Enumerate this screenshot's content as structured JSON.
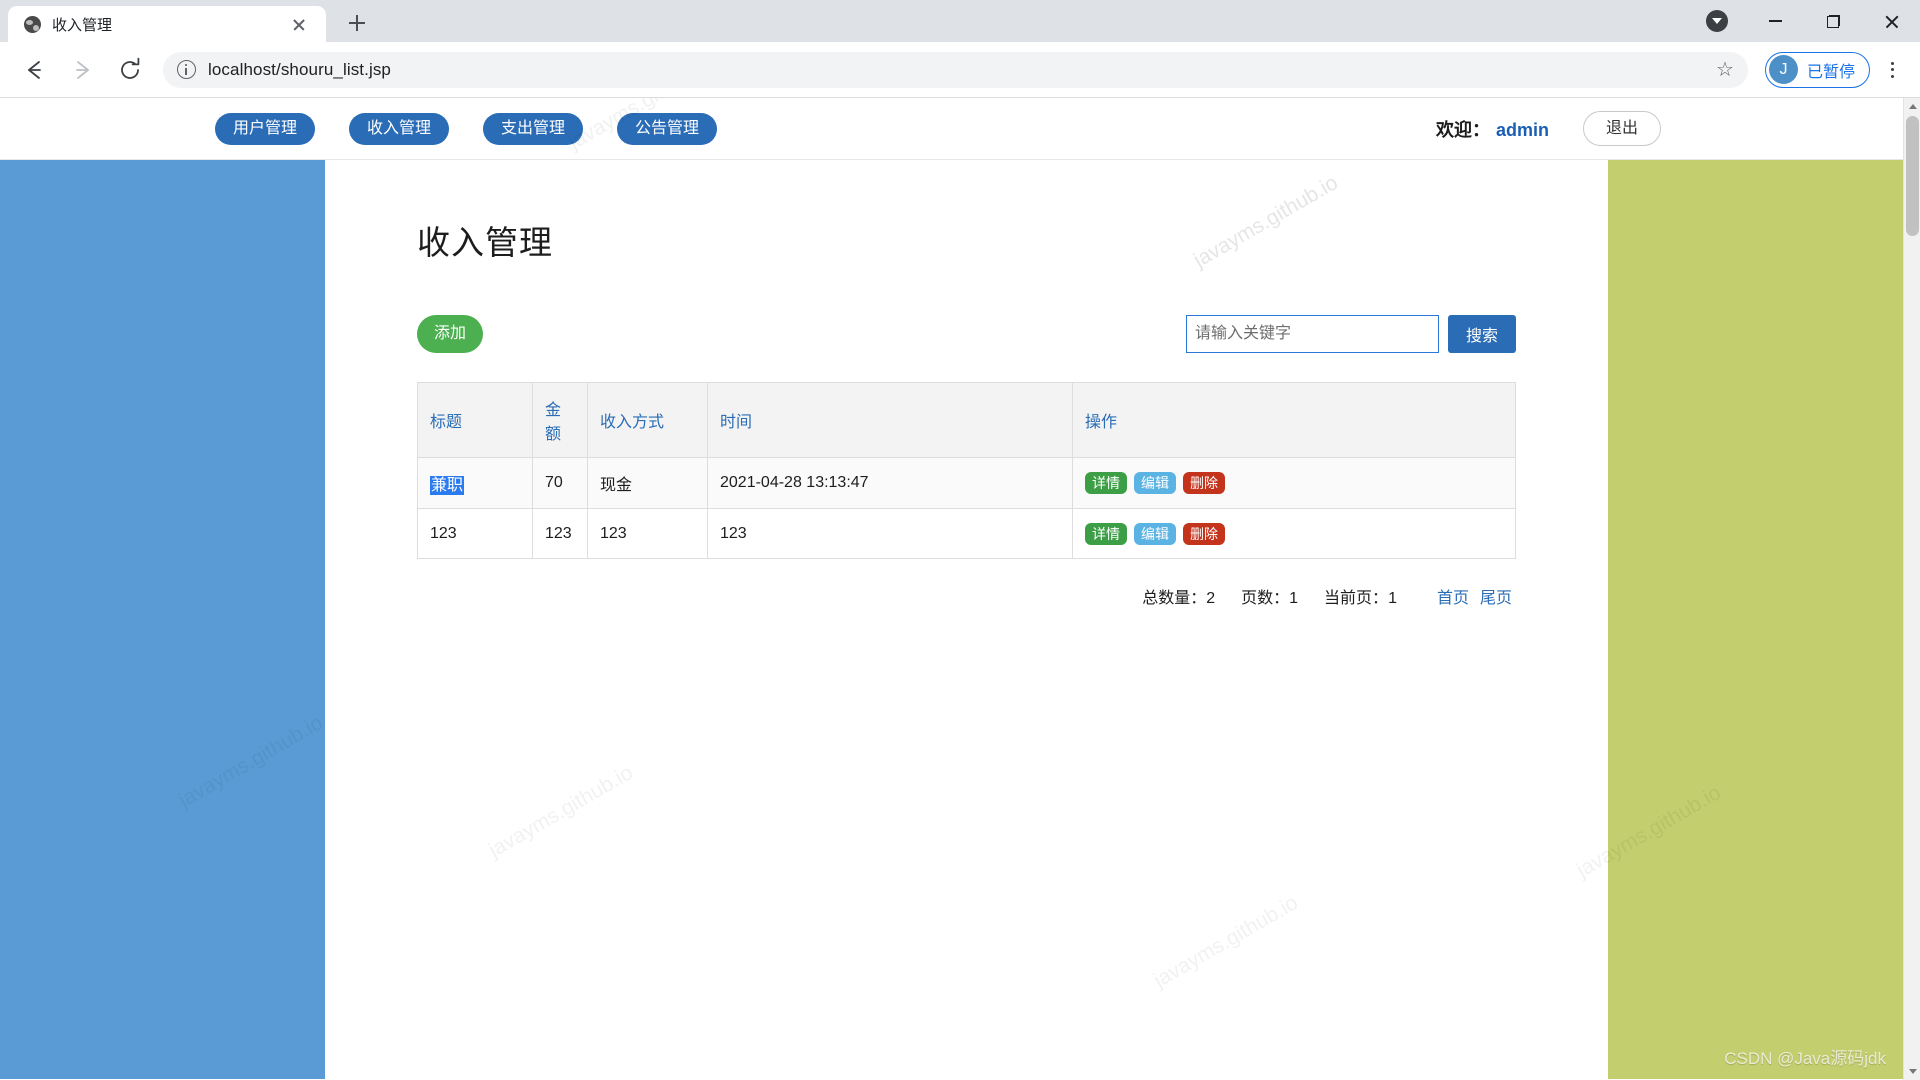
{
  "browser": {
    "tab": {
      "title": "收入管理",
      "favicon": "globe-icon",
      "close": "×"
    },
    "new_tab": "+",
    "url": "localhost/shouru_list.jsp",
    "profile": {
      "initial": "J",
      "label": "已暂停"
    },
    "window_controls": {
      "download": "download-icon",
      "minimize": "—",
      "maximize": "□",
      "close": "✕"
    }
  },
  "site": {
    "nav": [
      {
        "label": "用户管理"
      },
      {
        "label": "收入管理"
      },
      {
        "label": "支出管理"
      },
      {
        "label": "公告管理"
      }
    ],
    "welcome_prefix": "欢迎：",
    "welcome_user": "admin",
    "logout": "退出"
  },
  "main": {
    "title": "收入管理",
    "add_button": "添加",
    "search": {
      "placeholder": "请输入关键字",
      "value": "",
      "button": "搜索"
    },
    "table": {
      "headers": [
        "标题",
        "金额",
        "收入方式",
        "时间",
        "操作"
      ],
      "rows": [
        {
          "title": "兼职",
          "title_selected": true,
          "amount": "70",
          "way": "现金",
          "time": "2021-04-28 13:13:47",
          "actions": [
            "详情",
            "编辑",
            "删除"
          ]
        },
        {
          "title": "123",
          "title_selected": false,
          "amount": "123",
          "way": "123",
          "time": "123",
          "actions": [
            "详情",
            "编辑",
            "删除"
          ]
        }
      ]
    },
    "pager": {
      "total_label": "总数量：",
      "total_value": "2",
      "pages_label": "页数：",
      "pages_value": "1",
      "current_label": "当前页：",
      "current_value": "1",
      "first_page": "首页",
      "last_page": "尾页"
    }
  },
  "watermarks": {
    "site": "javayms.github.io",
    "csdn": "CSDN @Java源码jdk"
  },
  "colors": {
    "nav_pill": "#2a6cb5",
    "add_green": "#4caf50",
    "detail_green": "#3c9f46",
    "edit_blue": "#5bb3e4",
    "delete_red": "#c4341c",
    "side_blue": "#5a9bd5",
    "side_green": "#c3ce6e",
    "link_blue": "#2a6cb5",
    "selection_blue": "#2a7bf0"
  }
}
